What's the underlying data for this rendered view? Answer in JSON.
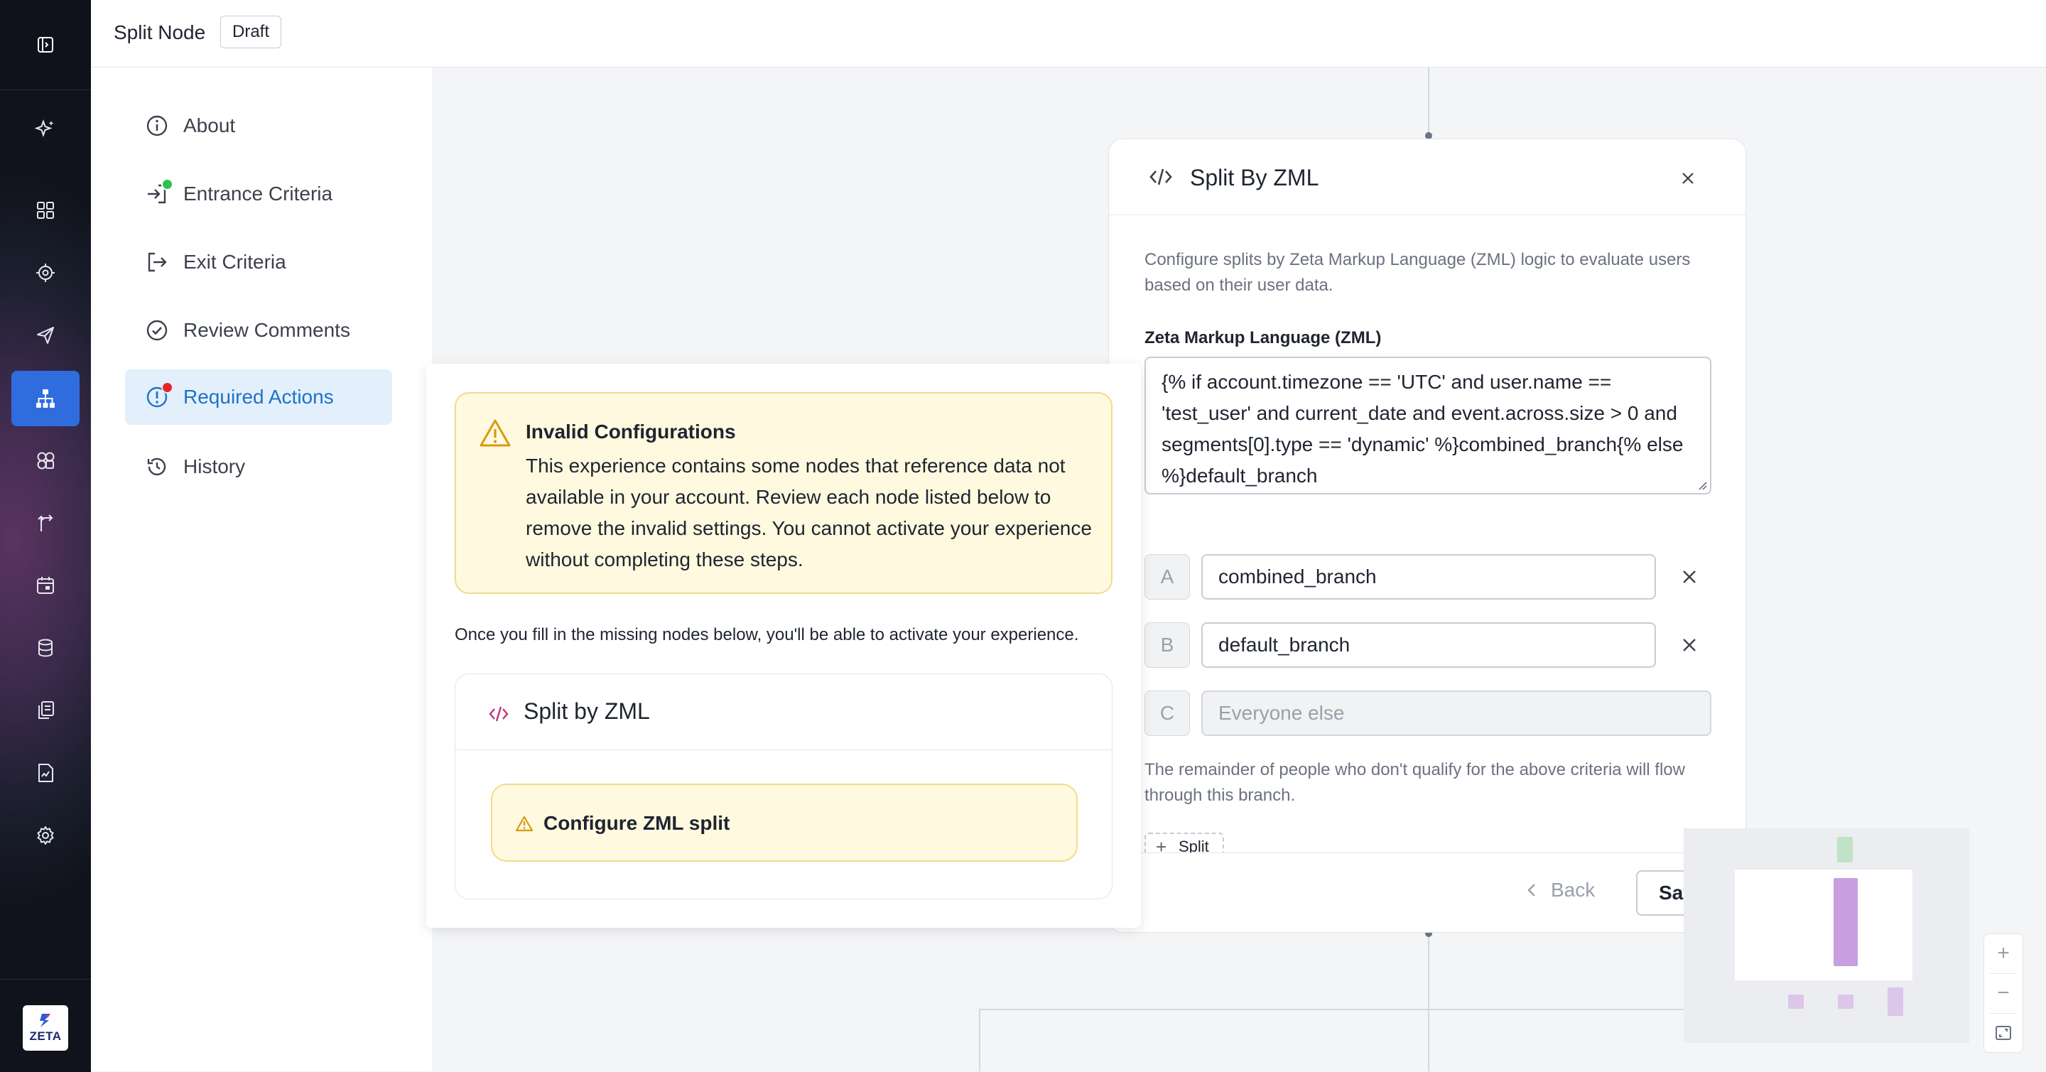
{
  "header": {
    "title": "Split Node",
    "status_badge": "Draft"
  },
  "sidenav": {
    "items": [
      {
        "label": "About",
        "icon": "info-circle-icon"
      },
      {
        "label": "Entrance Criteria",
        "icon": "sign-in-icon",
        "indicator": "#2ec24a"
      },
      {
        "label": "Exit Criteria",
        "icon": "sign-out-icon"
      },
      {
        "label": "Review Comments",
        "icon": "check-circle-icon"
      },
      {
        "label": "Required Actions",
        "icon": "alert-circle-icon",
        "indicator": "#e5252a",
        "active": true
      },
      {
        "label": "History",
        "icon": "history-icon"
      }
    ]
  },
  "required_actions": {
    "warning_title": "Invalid Configurations",
    "warning_text": "This experience contains some nodes that reference data not available in your account. Review each node listed below to remove the invalid settings. You cannot activate your experience without completing these steps.",
    "note": "Once you fill in the missing nodes below, you'll be able to activate your experience.",
    "card_title": "Split by ZML",
    "card_item": "Configure ZML split"
  },
  "split_panel": {
    "title": "Split By ZML",
    "description": "Configure splits by Zeta Markup Language (ZML) logic to evaluate users based on their user data.",
    "zml_label": "Zeta Markup Language (ZML)",
    "zml_value": "{% if account.timezone == 'UTC' and user.name == 'test_user' and current_date and event.across.size > 0 and segments[0].type == 'dynamic' %}combined_branch{% else %}default_branch",
    "branches": [
      {
        "letter": "A",
        "value": "combined_branch"
      },
      {
        "letter": "B",
        "value": "default_branch"
      }
    ],
    "everyone_else": {
      "letter": "C",
      "placeholder": "Everyone else"
    },
    "remainder_text": "The remainder of people who don't qualify for the above criteria will flow through this branch.",
    "add_split_label": "Split",
    "back_label": "Back",
    "save_label": "Sav"
  },
  "zoom": {
    "in": "+",
    "out": "−"
  },
  "colors": {
    "accent": "#2f6dde",
    "active_nav_bg": "#e3f0fb",
    "active_nav_text": "#1f72c8",
    "warning_bg": "#fff9df",
    "warning_border": "#f0dc8a",
    "zml_icon": "#c0327a"
  }
}
